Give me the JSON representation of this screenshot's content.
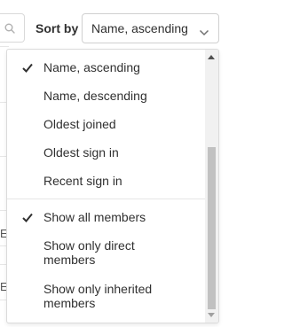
{
  "toolbar": {
    "search_icon": "search-icon",
    "sort_label": "Sort by",
    "sort_value": "Name, ascending",
    "chevron_icon": "chevron-down-icon"
  },
  "background": {
    "fragments": [
      "E",
      "E"
    ]
  },
  "dropdown": {
    "sort_options": [
      {
        "label": "Name, ascending",
        "checked": true
      },
      {
        "label": "Name, descending",
        "checked": false
      },
      {
        "label": "Oldest joined",
        "checked": false
      },
      {
        "label": "Oldest sign in",
        "checked": false
      },
      {
        "label": "Recent sign in",
        "checked": false
      }
    ],
    "member_options": [
      {
        "label": "Show all members",
        "checked": true
      },
      {
        "label": "Show only direct members",
        "checked": false
      },
      {
        "label": "Show only inherited members",
        "checked": false
      }
    ]
  },
  "colors": {
    "text": "#303030",
    "border": "#d0d0d0",
    "scrollbar_track": "#f1f1f1",
    "scrollbar_thumb": "#c1c1c1"
  }
}
